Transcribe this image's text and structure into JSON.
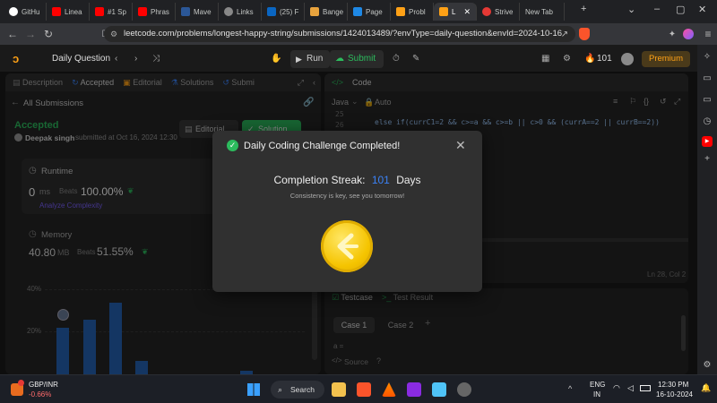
{
  "browser": {
    "tabs": [
      {
        "label": "GitHu",
        "color": "#ffffff"
      },
      {
        "label": "Linea",
        "color": "#ff0000"
      },
      {
        "label": "#1 Sp",
        "color": "#ff0000"
      },
      {
        "label": "Phras",
        "color": "#ff0000"
      },
      {
        "label": "Mave",
        "color": "#2b5797"
      },
      {
        "label": "Links",
        "color": "#888888"
      },
      {
        "label": "(25) F",
        "color": "#0a66c2"
      },
      {
        "label": "Bange",
        "color": "#e8a33d"
      },
      {
        "label": "Page",
        "color": "#1e88e5"
      },
      {
        "label": "Probl",
        "color": "#ffa116"
      },
      {
        "label": "L",
        "color": "#ffa116"
      },
      {
        "label": "Strive",
        "color": "#e53935"
      },
      {
        "label": "New Tab",
        "color": ""
      }
    ],
    "url": "leetcode.com/problems/longest-happy-string/submissions/1424013489/?envType=daily-question&envId=2024-10-16"
  },
  "header": {
    "daily_question": "Daily Question",
    "run": "Run",
    "submit": "Submit",
    "streak": "101",
    "premium": "Premium"
  },
  "left_panel": {
    "tabs": [
      "Description",
      "Accepted",
      "Editorial",
      "Solutions",
      "Submi"
    ],
    "all_submissions": "All Submissions",
    "status": "Accepted",
    "user": "Deepak singh",
    "submitted_at": "submitted at Oct 16, 2024 12:30",
    "editorial_btn": "Editorial",
    "solution_btn": "Solution",
    "runtime_label": "Runtime",
    "runtime_value": "0",
    "runtime_unit": "ms",
    "beats_label": "Beats",
    "runtime_beats": "100.00%",
    "analyze": "Analyze Complexity",
    "memory_label": "Memory",
    "memory_value": "40.80",
    "memory_unit": "MB",
    "memory_beats": "51.55%",
    "pct_40": "40%",
    "pct_20": "20%"
  },
  "code_panel": {
    "title": "Code",
    "language": "Java",
    "auto": "Auto",
    "line_25": "25",
    "line_26": "26",
    "code_line": "else if(currC1=2 && c>=a && c>=b ||  c>0 && (currA==2 || currB==2))",
    "cursor_pos": "Ln 28, Col 2"
  },
  "testcase_panel": {
    "tab_testcase": "Testcase",
    "tab_result": "Test Result",
    "case1": "Case 1",
    "case2": "Case 2",
    "var_a": "a =",
    "source": "Source"
  },
  "modal": {
    "title": "Daily Coding Challenge Completed!",
    "streak_label": "Completion Streak:",
    "streak_value": "101",
    "streak_unit": "Days",
    "subtitle": "Consistency is key, see you tomorrow!"
  },
  "taskbar": {
    "ticker": "GBP/INR",
    "ticker_change": "-0.66%",
    "search": "Search",
    "lang": "ENG",
    "region": "IN",
    "time": "12:30 PM",
    "date": "16-10-2024"
  },
  "colors": {
    "accent_green": "#2cbb5d",
    "leetcode_orange": "#ffa116",
    "streak_blue": "#3b82f6",
    "bar_blue": "#2563b5"
  }
}
